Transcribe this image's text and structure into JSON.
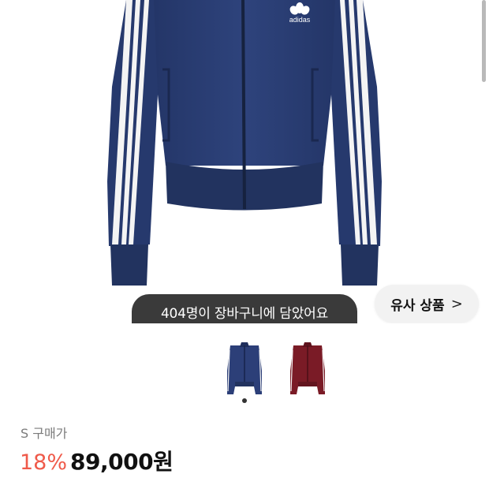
{
  "hero": {
    "brand_logo_text": "adidas",
    "toast_text": "404명이 장바구니에 담았어요",
    "similar_button_label": "유사 상품",
    "similar_button_chevron": ">"
  },
  "thumbnails": [
    {
      "name": "navy",
      "color": "#2c3f78"
    },
    {
      "name": "burgundy",
      "color": "#7a1b26"
    }
  ],
  "product": {
    "seller_label": "S 구매가",
    "discount": "18%",
    "price": "89,000원"
  }
}
